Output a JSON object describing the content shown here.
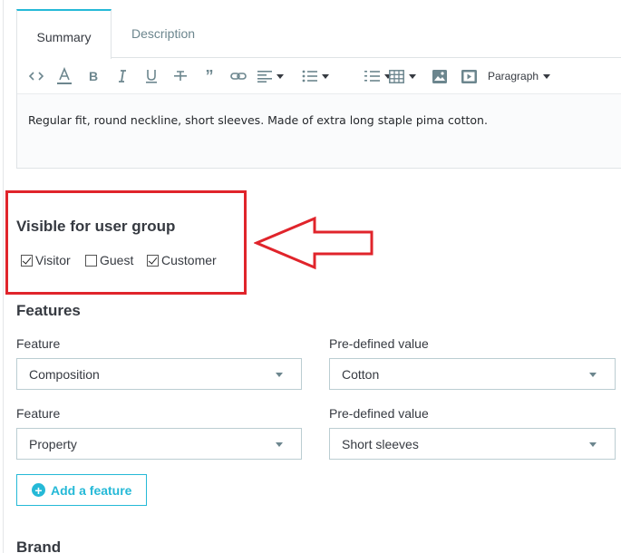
{
  "tabs": [
    {
      "label": "Summary",
      "active": true
    },
    {
      "label": "Description",
      "active": false
    }
  ],
  "toolbar": {
    "icons": [
      "code-view-icon",
      "text-color-icon",
      "bold-icon",
      "italic-icon",
      "underline-icon",
      "strikethrough-icon",
      "blockquote-icon",
      "link-icon",
      "align-icon",
      "bullet-list-icon",
      "numbered-list-icon",
      "table-icon",
      "image-icon",
      "media-icon"
    ],
    "paragraph_label": "Paragraph"
  },
  "editor": {
    "content": "Regular fit, round neckline, short sleeves. Made of extra long staple pima cotton."
  },
  "user_group": {
    "title": "Visible for user group",
    "options": [
      {
        "label": "Visitor",
        "checked": true
      },
      {
        "label": "Guest",
        "checked": false
      },
      {
        "label": "Customer",
        "checked": true
      }
    ]
  },
  "features": {
    "title": "Features",
    "rows": [
      {
        "feature_label": "Feature",
        "feature_value": "Composition",
        "value_label": "Pre-defined value",
        "value": "Cotton"
      },
      {
        "feature_label": "Feature",
        "feature_value": "Property",
        "value_label": "Pre-defined value",
        "value": "Short sleeves"
      }
    ],
    "add_button": "Add a feature"
  },
  "brand": {
    "title": "Brand"
  },
  "colors": {
    "accent": "#25b9d7",
    "highlight": "#e0242b",
    "text": "#363a41"
  }
}
